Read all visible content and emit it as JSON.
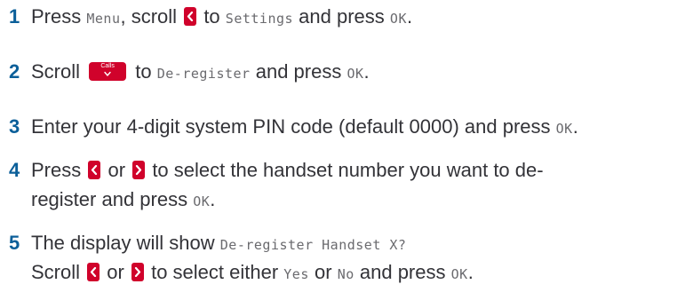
{
  "steps": [
    {
      "number": "1",
      "parts": {
        "a": "Press",
        "b": "Menu",
        "c": ", scroll",
        "d": "to",
        "e": "Settings",
        "f": "and press",
        "g": "OK",
        "h": "."
      }
    },
    {
      "number": "2",
      "parts": {
        "a": "Scroll",
        "calls_key": "Calls",
        "b": "to",
        "c": "De-register",
        "d": "and press",
        "e": "OK",
        "f": "."
      }
    },
    {
      "number": "3",
      "parts": {
        "a": "Enter your 4-digit system PIN code (default 0000) and press",
        "b": "OK",
        "c": "."
      }
    },
    {
      "number": "4",
      "parts": {
        "a": "Press",
        "b": "or",
        "c": "to select the handset number you want to de-",
        "d": "register and press",
        "e": "OK",
        "f": "."
      }
    },
    {
      "number": "5",
      "parts": {
        "a": "The display will show",
        "b": "De-register Handset X?",
        "c": "Scroll",
        "d": "or",
        "e": "to select either",
        "f": "Yes",
        "g": "or",
        "h": "No",
        "i": "and press",
        "j": "OK",
        "k": "."
      }
    }
  ],
  "icons": {
    "left_key": "left-arrow-key-icon",
    "right_key": "right-arrow-key-icon",
    "calls_key": "calls-down-key-icon"
  },
  "colors": {
    "step_number": "#0b5f99",
    "key_background": "#d0022b",
    "body_text": "#333338",
    "display_text": "#6a6a6e"
  }
}
